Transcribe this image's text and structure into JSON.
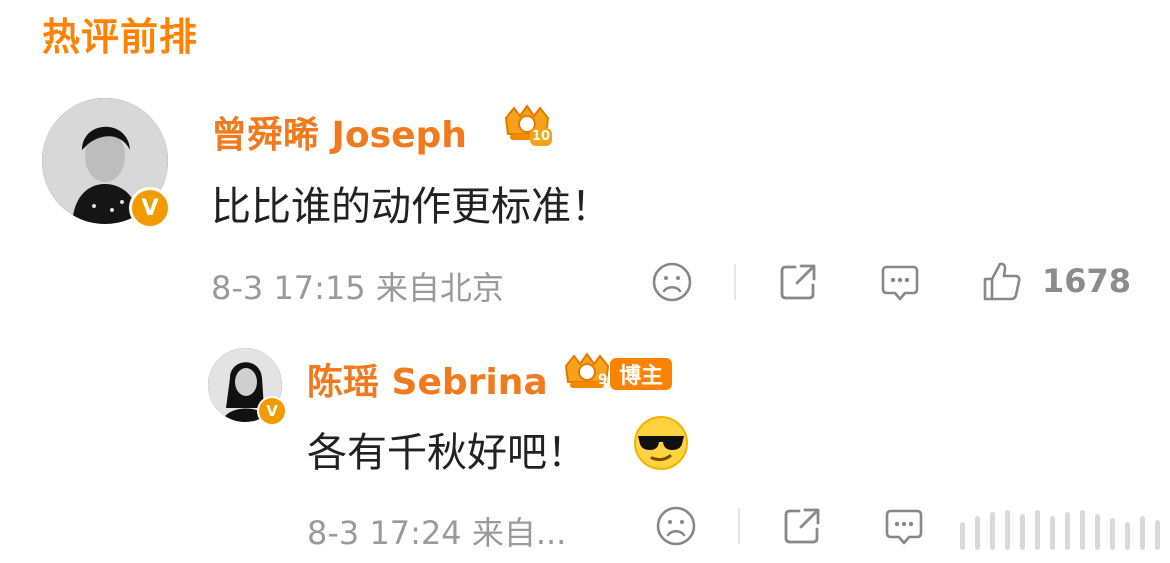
{
  "section": {
    "title": "热评前排"
  },
  "comment": {
    "username": "曾舜晞 Joseph",
    "crown_level": "10",
    "verified_mark": "V",
    "text": "比比谁的动作更标准！",
    "meta": "8-3 17:15  来自北京",
    "like_count": "1678",
    "icons": {
      "dislike": "sad-face-icon",
      "share": "share-icon",
      "comment": "comment-bubble-icon",
      "like": "thumbs-up-icon"
    }
  },
  "reply": {
    "username": "陈瑶 Sebrina",
    "crown_level": "9",
    "tag": "博主",
    "verified_mark": "V",
    "text": "各有千秋好吧！",
    "emoji": "sunglasses-emoji",
    "meta": "8-3 17:24  来自..."
  },
  "colors": {
    "accent": "#ff8200",
    "username": "#f07a1d",
    "gray": "#9a9a9a",
    "badge": "#f29b00"
  }
}
